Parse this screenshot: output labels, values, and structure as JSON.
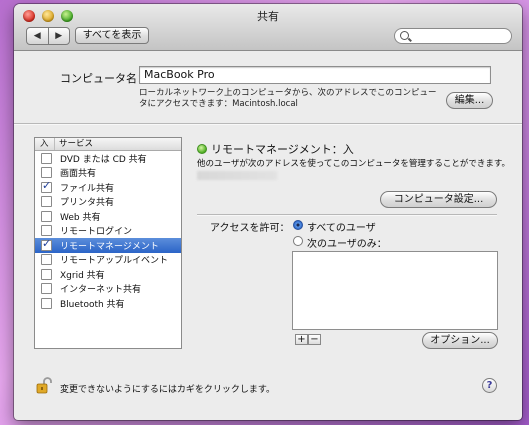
{
  "window": {
    "title": "共有"
  },
  "toolbar": {
    "show_all": "すべてを表示",
    "back": "◀",
    "forward": "▶",
    "search_placeholder": ""
  },
  "computer": {
    "label": "コンピュータ名：",
    "name": "MacBook Pro",
    "note": "ローカルネットワーク上のコンピュータから、次のアドレスでこのコンピュータにアクセスできます：Macintosh.local",
    "edit_button": "編集..."
  },
  "services": {
    "col_on": "入",
    "col_service": "サービス",
    "items": [
      {
        "label": "DVD または CD 共有",
        "checked": false,
        "selected": false
      },
      {
        "label": "画面共有",
        "checked": false,
        "selected": false
      },
      {
        "label": "ファイル共有",
        "checked": true,
        "selected": false
      },
      {
        "label": "プリンタ共有",
        "checked": false,
        "selected": false
      },
      {
        "label": "Web 共有",
        "checked": false,
        "selected": false
      },
      {
        "label": "リモートログイン",
        "checked": false,
        "selected": false
      },
      {
        "label": "リモートマネージメント",
        "checked": true,
        "selected": true
      },
      {
        "label": "リモートアップルイベント",
        "checked": false,
        "selected": false
      },
      {
        "label": "Xgrid 共有",
        "checked": false,
        "selected": false
      },
      {
        "label": "インターネット共有",
        "checked": false,
        "selected": false
      },
      {
        "label": "Bluetooth 共有",
        "checked": false,
        "selected": false
      }
    ]
  },
  "detail": {
    "status": "リモートマネージメント：入",
    "description": "他のユーザが次のアドレスを使ってこのコンピュータを管理することができます。",
    "computer_settings_button": "コンピュータ設定...",
    "access_label": "アクセスを許可：",
    "radio_all": "すべてのユーザ",
    "radio_only": "次のユーザのみ：",
    "options_button": "オプション...",
    "add": "+",
    "remove": "−"
  },
  "footer": {
    "lock_text": "変更できないようにするにはカギをクリックします。",
    "help": "?"
  },
  "colors": {
    "selection": "#2b64c7",
    "status_on": "#4fae23"
  }
}
